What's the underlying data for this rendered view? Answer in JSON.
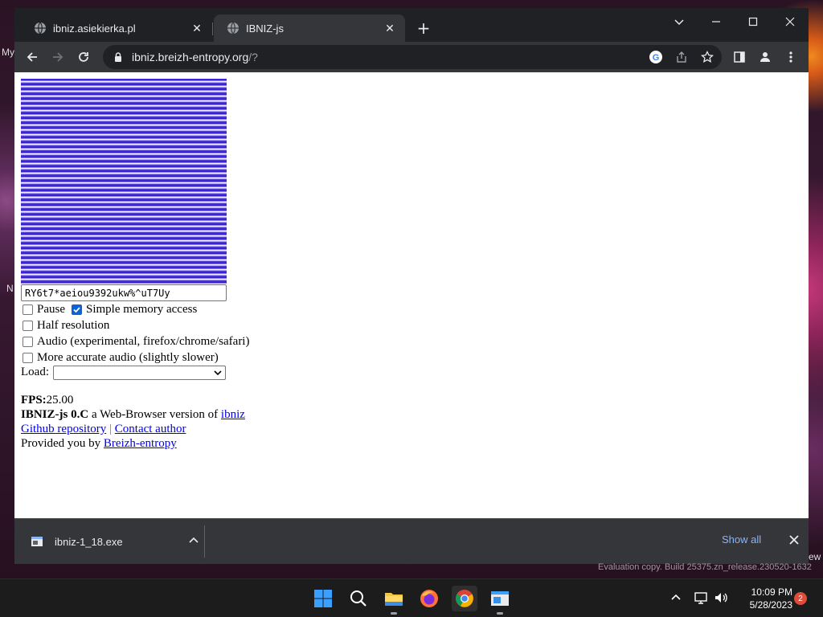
{
  "desktop": {
    "left_fragment_1": "My",
    "left_fragment_2": "N",
    "right_fragment": "ew",
    "watermark": "Evaluation copy. Build 25375.zn_release.230520-1632"
  },
  "browser": {
    "tabs": [
      {
        "title": "ibniz.asiekierka.pl",
        "active": false
      },
      {
        "title": "IBNIZ-js",
        "active": true
      }
    ],
    "omnibox": {
      "host": "ibniz.breizh-entropy.org",
      "path": "/?"
    }
  },
  "page": {
    "code_value": "RY6t7*aeiou9392ukw%^uT7Uy",
    "options": {
      "pause": {
        "label": "Pause",
        "checked": false
      },
      "simple_memory": {
        "label": "Simple memory access",
        "checked": true
      },
      "half_resolution": {
        "label": "Half resolution",
        "checked": false
      },
      "audio": {
        "label": "Audio (experimental, firefox/chrome/safari)",
        "checked": false
      },
      "accurate_audio": {
        "label": "More accurate audio (slightly slower)",
        "checked": false
      }
    },
    "load": {
      "label": "Load:",
      "selected": ""
    },
    "fps": {
      "label": "FPS:",
      "value": "25.00"
    },
    "about": {
      "name": "IBNIZ-js 0.C",
      "text": " a Web-Browser version of ",
      "link": "ibniz"
    },
    "links": {
      "github": "Github repository",
      "separator": "|",
      "contact": "Contact author"
    },
    "credit": {
      "text": "Provided you by ",
      "link": "Breizh-entropy"
    }
  },
  "downloads": {
    "file": "ibniz-1_18.exe",
    "show_all": "Show all"
  },
  "taskbar": {
    "time": "10:09 PM",
    "date": "5/28/2023",
    "notifications": "2"
  },
  "colors": {
    "accent": "#0b63d6",
    "link": "#0000ee",
    "chrome_dark": "#202124",
    "chrome_toolbar": "#35363a"
  }
}
